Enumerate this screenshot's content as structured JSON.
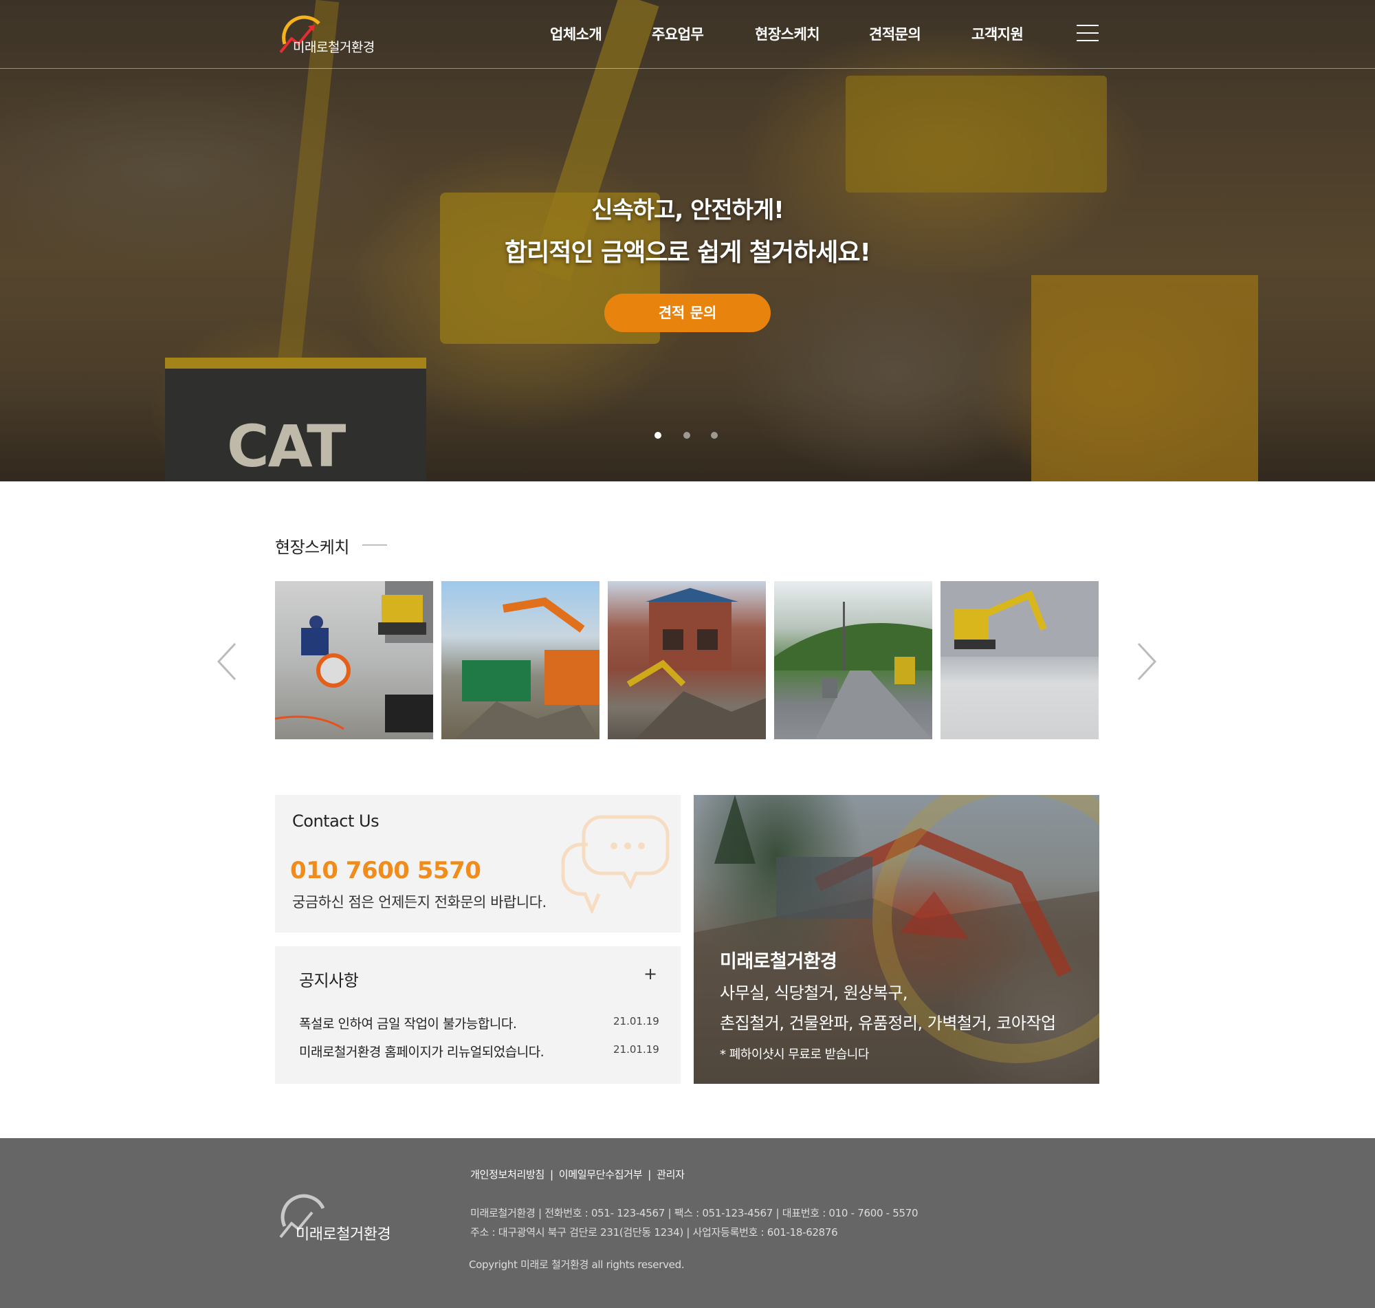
{
  "brand": {
    "name": "미래로철거환경"
  },
  "nav": {
    "items": [
      "업체소개",
      "주요업무",
      "현장스케치",
      "견적문의",
      "고객지원"
    ]
  },
  "hero": {
    "line1": "신속하고, 안전하게!",
    "line2": "합리적인 금액으로 쉽게 철거하세요!",
    "cta_label": "견적 문의",
    "cta_color": "#e8830e",
    "slide_count": 3,
    "active_slide": 1,
    "sign_text": "CAT"
  },
  "gallery": {
    "title": "현장스케치",
    "prev_icon": "chevron-left-icon",
    "next_icon": "chevron-right-icon",
    "items": [
      "thumbnail-1",
      "thumbnail-2",
      "thumbnail-3",
      "thumbnail-4",
      "thumbnail-5"
    ]
  },
  "contact": {
    "title": "Contact Us",
    "phone": "010 7600 5570",
    "description": "궁금하신 점은 언제든지 전화문의 바랍니다.",
    "accent_color": "#f08c1c",
    "icon": "chat-bubble-icon"
  },
  "notice": {
    "title": "공지사항",
    "more": "+",
    "items": [
      {
        "text": "폭설로 인하여 금일 작업이 불가능합니다.",
        "date": "21.01.19"
      },
      {
        "text": "미래로철거환경 홈페이지가 리뉴얼되었습니다.",
        "date": "21.01.19"
      }
    ]
  },
  "promo": {
    "title": "미래로철거환경",
    "line1": "사무실, 식당철거, 원상복구,",
    "line2": "촌집철거, 건물완파, 유품정리, 가벽철거, 코아작업",
    "note": "* 폐하이샷시 무료로 받습니다"
  },
  "footer": {
    "links": [
      "개인정보처리방침",
      "이메일무단수집거부",
      "관리자"
    ],
    "info1": "미래로철거환경  |  전화번호 : 051- 123-4567  |  팩스 : 051-123-4567  |  대표번호 : 010 - 7600 - 5570",
    "info2": "주소 : 대구광역시 북구 검단로 231(검단동 1234)  |  사업자등록번호 : 601-18-62876",
    "copyright": "Copyright 미래로 철거환경 all rights reserved.",
    "background": "#666666"
  }
}
